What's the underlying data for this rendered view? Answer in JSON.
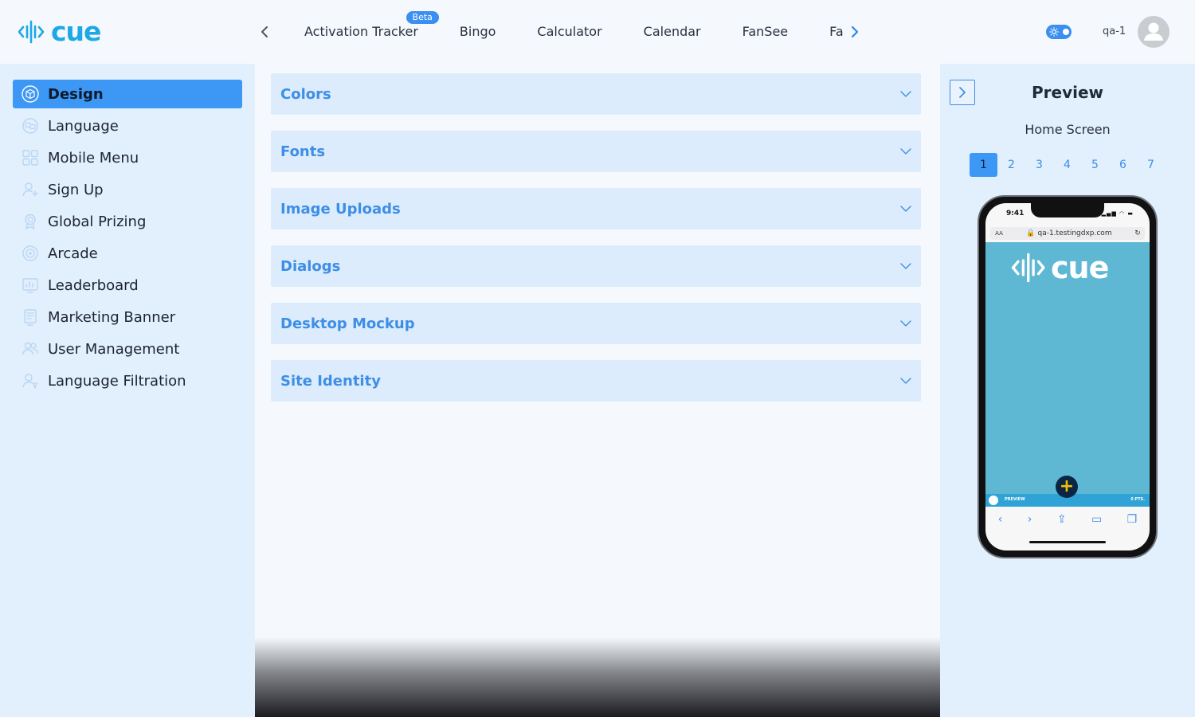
{
  "brand": {
    "logo_text": "cue",
    "color": "#1ea8e6"
  },
  "tabs": {
    "items": [
      {
        "label": "Activation Tracker",
        "badge": "Beta"
      },
      {
        "label": "Bingo"
      },
      {
        "label": "Calculator"
      },
      {
        "label": "Calendar"
      },
      {
        "label": "FanSee"
      },
      {
        "label": "Fa"
      }
    ]
  },
  "user": {
    "name": "qa-1"
  },
  "sidebar": {
    "items": [
      {
        "label": "Design",
        "icon": "cube-icon",
        "active": true
      },
      {
        "label": "Language",
        "icon": "language-icon"
      },
      {
        "label": "Mobile Menu",
        "icon": "grid-icon"
      },
      {
        "label": "Sign Up",
        "icon": "user-plus-icon"
      },
      {
        "label": "Global Prizing",
        "icon": "award-icon"
      },
      {
        "label": "Arcade",
        "icon": "target-icon"
      },
      {
        "label": "Leaderboard",
        "icon": "chart-icon"
      },
      {
        "label": "Marketing Banner",
        "icon": "banner-icon"
      },
      {
        "label": "User Management",
        "icon": "users-icon"
      },
      {
        "label": "Language Filtration",
        "icon": "user-filter-icon"
      }
    ]
  },
  "sections": [
    {
      "title": "Colors"
    },
    {
      "title": "Fonts"
    },
    {
      "title": "Image Uploads"
    },
    {
      "title": "Dialogs"
    },
    {
      "title": "Desktop Mockup"
    },
    {
      "title": "Site Identity"
    }
  ],
  "preview": {
    "title": "Preview",
    "subtitle": "Home Screen",
    "pages": [
      "1",
      "2",
      "3",
      "4",
      "5",
      "6",
      "7"
    ],
    "active_page": "1",
    "phone": {
      "time": "9:41",
      "url_aa": "AA",
      "url": "qa-1.testingdxp.com",
      "site_logo_text": "cue",
      "bottom_left": "PREVIEW",
      "bottom_right": "0 PTS.",
      "site_bg": "#5fb8d3"
    }
  },
  "colors": {
    "accent": "#3d98f5",
    "panel": "#e2effc",
    "section_bg": "#dcecfc",
    "section_title": "#3d8ee6"
  }
}
